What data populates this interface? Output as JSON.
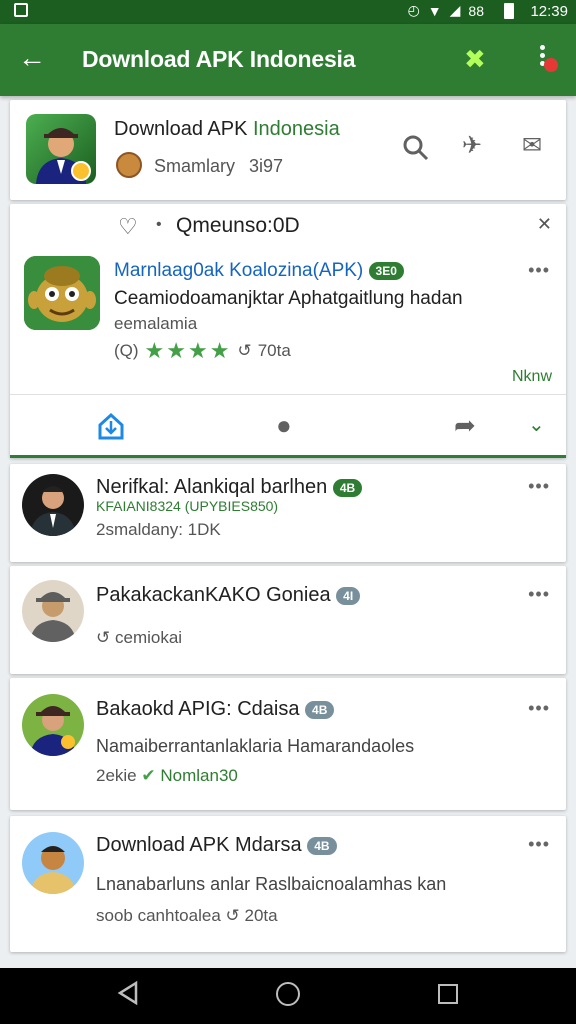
{
  "status_bar": {
    "time": "12:39",
    "signal_text": "88"
  },
  "app_bar": {
    "title": "Download APK Indonesia"
  },
  "header": {
    "title_part1": "Download APK",
    "title_part2": "Indonesia",
    "subtitle": "Smamlary",
    "count": "3i97"
  },
  "feature": {
    "heading": "Qmeunso:0D",
    "title": "Marnlaag0ak Koalozina(APK)",
    "badge": "3E0",
    "desc": "Ceamiodoamanjktar Aphatgaitlung hadan",
    "desc2": "eemalamia",
    "rating_icon": "(Q)",
    "rating_count": "70ta",
    "new_label": "Nknw"
  },
  "list": [
    {
      "title": "Nerifkal: Alankiqal barlhen",
      "badge": "4B",
      "sub": "KFAIANI8324 (UPYBIES850)",
      "meta": "2smaldany: 1DK"
    },
    {
      "title": "PakakackanKAKO Goniea",
      "badge": "4I",
      "meta": "cemiokai"
    },
    {
      "title": "Bakaokd APIG: Cdaisa",
      "badge": "4B",
      "sub": "Namaiberrantanlaklaria Hamarandaoles",
      "meta_prefix": "2ekie",
      "meta_green": "Nomlan30"
    },
    {
      "title": "Download APK Mdarsa",
      "badge": "4B",
      "sub": "Lnanabarluns anlar Raslbaicnoalamhas kan",
      "meta": "soob canhtoalea",
      "meta_suffix": "20ta"
    }
  ],
  "colors": {
    "appbar": "#2e7d32",
    "statusbar": "#1b5e20",
    "accent": "#43a047",
    "link_blue": "#1565c0"
  }
}
